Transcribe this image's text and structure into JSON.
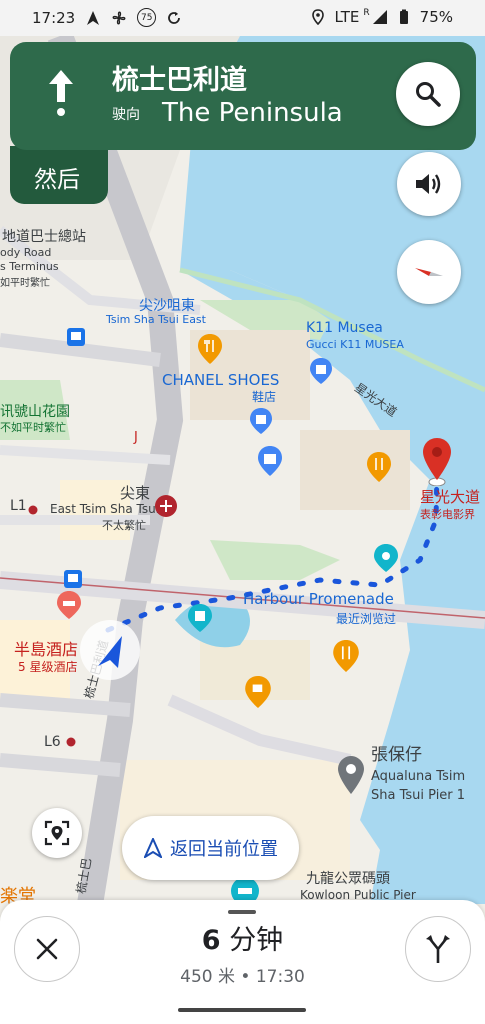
{
  "status": {
    "time": "17:23",
    "nfc": "75",
    "network": "LTE",
    "roam": "R",
    "battery": "75%"
  },
  "nav": {
    "street": "梳士巴利道",
    "toward_label": "驶向",
    "destination": "The Peninsula",
    "then_label": "然后"
  },
  "map_labels": {
    "bus_terminus_cn": "地道巴士總站",
    "bus_terminus_en1": "ody Road",
    "bus_terminus_en2": "s Terminus",
    "bus_terminus_status": "如平时繁忙",
    "tst_east_cn": "尖沙咀東",
    "tst_east_en": "Tsim Sha Tsui East",
    "k11_en": "K11 Musea",
    "k11_sub": "Gucci K11 MUSEA",
    "chanel": "CHANEL SHOES",
    "shoe_shop": "鞋店",
    "avenue_road": "星光大道",
    "garden": "讯號山花園",
    "garden_status": "不如平时繁忙",
    "east_tst_cn": "尖東",
    "east_tst_en": "East Tsim Sha Tsui",
    "east_tst_status": "不太繁忙",
    "l1": "L1",
    "l6": "L6",
    "avenue_stars": "星光大道",
    "avenue_stars_sub": "表彰电影界",
    "harbour": "Harbour Promenade",
    "harbour_sub": "最近浏览过",
    "peninsula_cn": "半島酒店",
    "peninsula_sub": "5 星级酒店",
    "road_vertical": "梳士巴利道",
    "road_vertical2": "梳士巴",
    "cheung": "張保仔",
    "aqualuna1": "Aqualuna Tsim",
    "aqualuna2": "Sha Tsui Pier 1",
    "pier_cn": "九龍公眾碼頭",
    "pier_en": "Kowloon Public Pier",
    "church": "楽堂",
    "j_label": "J"
  },
  "recenter_label": "返回当前位置",
  "trip": {
    "minutes": "6",
    "unit": "分钟",
    "distance": "450 米",
    "arrival": "17:30"
  },
  "icons": {
    "search": "search-icon",
    "sound": "volume-icon",
    "compass": "compass-icon",
    "close": "close-icon",
    "alt": "alternate-routes-icon",
    "lens": "lens-icon"
  },
  "colors": {
    "nav_green": "#2e6a4b",
    "nav_dark": "#235a3d",
    "route_blue": "#1a56db",
    "water": "#a8d8f0"
  }
}
